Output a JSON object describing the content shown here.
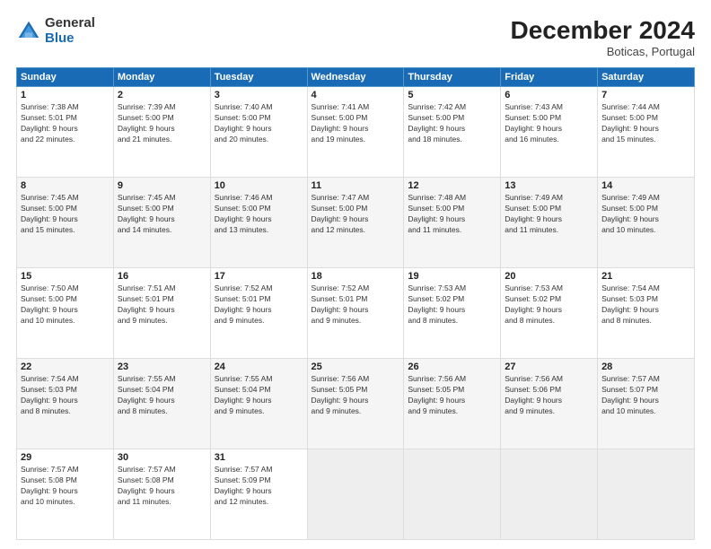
{
  "header": {
    "logo_general": "General",
    "logo_blue": "Blue",
    "month_title": "December 2024",
    "subtitle": "Boticas, Portugal"
  },
  "days_of_week": [
    "Sunday",
    "Monday",
    "Tuesday",
    "Wednesday",
    "Thursday",
    "Friday",
    "Saturday"
  ],
  "weeks": [
    [
      {
        "day": "1",
        "info": "Sunrise: 7:38 AM\nSunset: 5:01 PM\nDaylight: 9 hours\nand 22 minutes."
      },
      {
        "day": "2",
        "info": "Sunrise: 7:39 AM\nSunset: 5:00 PM\nDaylight: 9 hours\nand 21 minutes."
      },
      {
        "day": "3",
        "info": "Sunrise: 7:40 AM\nSunset: 5:00 PM\nDaylight: 9 hours\nand 20 minutes."
      },
      {
        "day": "4",
        "info": "Sunrise: 7:41 AM\nSunset: 5:00 PM\nDaylight: 9 hours\nand 19 minutes."
      },
      {
        "day": "5",
        "info": "Sunrise: 7:42 AM\nSunset: 5:00 PM\nDaylight: 9 hours\nand 18 minutes."
      },
      {
        "day": "6",
        "info": "Sunrise: 7:43 AM\nSunset: 5:00 PM\nDaylight: 9 hours\nand 16 minutes."
      },
      {
        "day": "7",
        "info": "Sunrise: 7:44 AM\nSunset: 5:00 PM\nDaylight: 9 hours\nand 15 minutes."
      }
    ],
    [
      {
        "day": "8",
        "info": "Sunrise: 7:45 AM\nSunset: 5:00 PM\nDaylight: 9 hours\nand 15 minutes."
      },
      {
        "day": "9",
        "info": "Sunrise: 7:45 AM\nSunset: 5:00 PM\nDaylight: 9 hours\nand 14 minutes."
      },
      {
        "day": "10",
        "info": "Sunrise: 7:46 AM\nSunset: 5:00 PM\nDaylight: 9 hours\nand 13 minutes."
      },
      {
        "day": "11",
        "info": "Sunrise: 7:47 AM\nSunset: 5:00 PM\nDaylight: 9 hours\nand 12 minutes."
      },
      {
        "day": "12",
        "info": "Sunrise: 7:48 AM\nSunset: 5:00 PM\nDaylight: 9 hours\nand 11 minutes."
      },
      {
        "day": "13",
        "info": "Sunrise: 7:49 AM\nSunset: 5:00 PM\nDaylight: 9 hours\nand 11 minutes."
      },
      {
        "day": "14",
        "info": "Sunrise: 7:49 AM\nSunset: 5:00 PM\nDaylight: 9 hours\nand 10 minutes."
      }
    ],
    [
      {
        "day": "15",
        "info": "Sunrise: 7:50 AM\nSunset: 5:00 PM\nDaylight: 9 hours\nand 10 minutes."
      },
      {
        "day": "16",
        "info": "Sunrise: 7:51 AM\nSunset: 5:01 PM\nDaylight: 9 hours\nand 9 minutes."
      },
      {
        "day": "17",
        "info": "Sunrise: 7:52 AM\nSunset: 5:01 PM\nDaylight: 9 hours\nand 9 minutes."
      },
      {
        "day": "18",
        "info": "Sunrise: 7:52 AM\nSunset: 5:01 PM\nDaylight: 9 hours\nand 9 minutes."
      },
      {
        "day": "19",
        "info": "Sunrise: 7:53 AM\nSunset: 5:02 PM\nDaylight: 9 hours\nand 8 minutes."
      },
      {
        "day": "20",
        "info": "Sunrise: 7:53 AM\nSunset: 5:02 PM\nDaylight: 9 hours\nand 8 minutes."
      },
      {
        "day": "21",
        "info": "Sunrise: 7:54 AM\nSunset: 5:03 PM\nDaylight: 9 hours\nand 8 minutes."
      }
    ],
    [
      {
        "day": "22",
        "info": "Sunrise: 7:54 AM\nSunset: 5:03 PM\nDaylight: 9 hours\nand 8 minutes."
      },
      {
        "day": "23",
        "info": "Sunrise: 7:55 AM\nSunset: 5:04 PM\nDaylight: 9 hours\nand 8 minutes."
      },
      {
        "day": "24",
        "info": "Sunrise: 7:55 AM\nSunset: 5:04 PM\nDaylight: 9 hours\nand 9 minutes."
      },
      {
        "day": "25",
        "info": "Sunrise: 7:56 AM\nSunset: 5:05 PM\nDaylight: 9 hours\nand 9 minutes."
      },
      {
        "day": "26",
        "info": "Sunrise: 7:56 AM\nSunset: 5:05 PM\nDaylight: 9 hours\nand 9 minutes."
      },
      {
        "day": "27",
        "info": "Sunrise: 7:56 AM\nSunset: 5:06 PM\nDaylight: 9 hours\nand 9 minutes."
      },
      {
        "day": "28",
        "info": "Sunrise: 7:57 AM\nSunset: 5:07 PM\nDaylight: 9 hours\nand 10 minutes."
      }
    ],
    [
      {
        "day": "29",
        "info": "Sunrise: 7:57 AM\nSunset: 5:08 PM\nDaylight: 9 hours\nand 10 minutes."
      },
      {
        "day": "30",
        "info": "Sunrise: 7:57 AM\nSunset: 5:08 PM\nDaylight: 9 hours\nand 11 minutes."
      },
      {
        "day": "31",
        "info": "Sunrise: 7:57 AM\nSunset: 5:09 PM\nDaylight: 9 hours\nand 12 minutes."
      },
      {
        "day": "",
        "info": ""
      },
      {
        "day": "",
        "info": ""
      },
      {
        "day": "",
        "info": ""
      },
      {
        "day": "",
        "info": ""
      }
    ]
  ]
}
